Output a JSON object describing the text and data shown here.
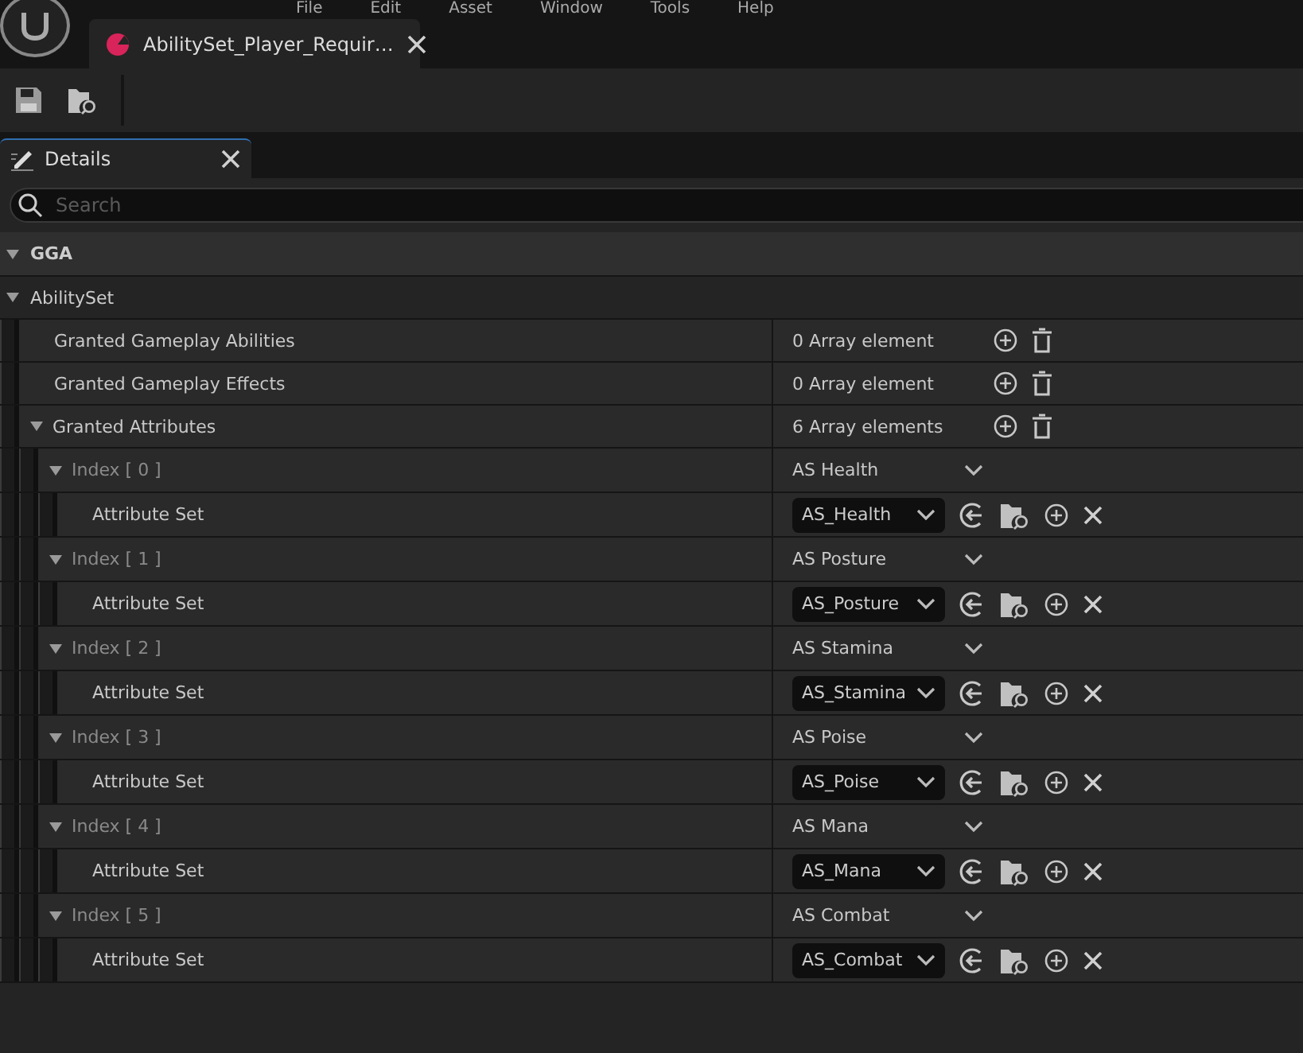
{
  "menu": [
    "File",
    "Edit",
    "Asset",
    "Window",
    "Tools",
    "Help"
  ],
  "document_tab": {
    "title": "AbilitySet_Player_Requir…",
    "selected": true
  },
  "panel_tab": {
    "title": "Details",
    "selected": true
  },
  "search": {
    "placeholder": "Search"
  },
  "categories": [
    {
      "label": "GGA",
      "expanded": true
    },
    {
      "label": "AbilitySet",
      "expanded": true,
      "properties": [
        {
          "name": "Granted Gameplay Abilities",
          "kind": "array",
          "value": "0 Array element"
        },
        {
          "name": "Granted Gameplay Effects",
          "kind": "array",
          "value": "0 Array element"
        },
        {
          "name": "Granted Attributes",
          "kind": "array",
          "value": "6 Array elements",
          "expanded": true,
          "children": [
            {
              "name": "Index [ 0 ]",
              "kind": "element",
              "value": "AS Health",
              "expanded": true,
              "children": [
                {
                  "name": "Attribute Set",
                  "kind": "asset",
                  "value": "AS_Health"
                }
              ]
            },
            {
              "name": "Index [ 1 ]",
              "kind": "element",
              "value": "AS Posture",
              "expanded": true,
              "children": [
                {
                  "name": "Attribute Set",
                  "kind": "asset",
                  "value": "AS_Posture"
                }
              ]
            },
            {
              "name": "Index [ 2 ]",
              "kind": "element",
              "value": "AS Stamina",
              "expanded": true,
              "children": [
                {
                  "name": "Attribute Set",
                  "kind": "asset",
                  "value": "AS_Stamina"
                }
              ]
            },
            {
              "name": "Index [ 3 ]",
              "kind": "element",
              "value": "AS Poise",
              "expanded": true,
              "children": [
                {
                  "name": "Attribute Set",
                  "kind": "asset",
                  "value": "AS_Poise"
                }
              ]
            },
            {
              "name": "Index [ 4 ]",
              "kind": "element",
              "value": "AS Mana",
              "expanded": true,
              "children": [
                {
                  "name": "Attribute Set",
                  "kind": "asset",
                  "value": "AS_Mana"
                }
              ]
            },
            {
              "name": "Index [ 5 ]",
              "kind": "element",
              "value": "AS Combat",
              "expanded": true,
              "children": [
                {
                  "name": "Attribute Set",
                  "kind": "asset",
                  "value": "AS_Combat"
                }
              ]
            }
          ]
        }
      ]
    }
  ]
}
